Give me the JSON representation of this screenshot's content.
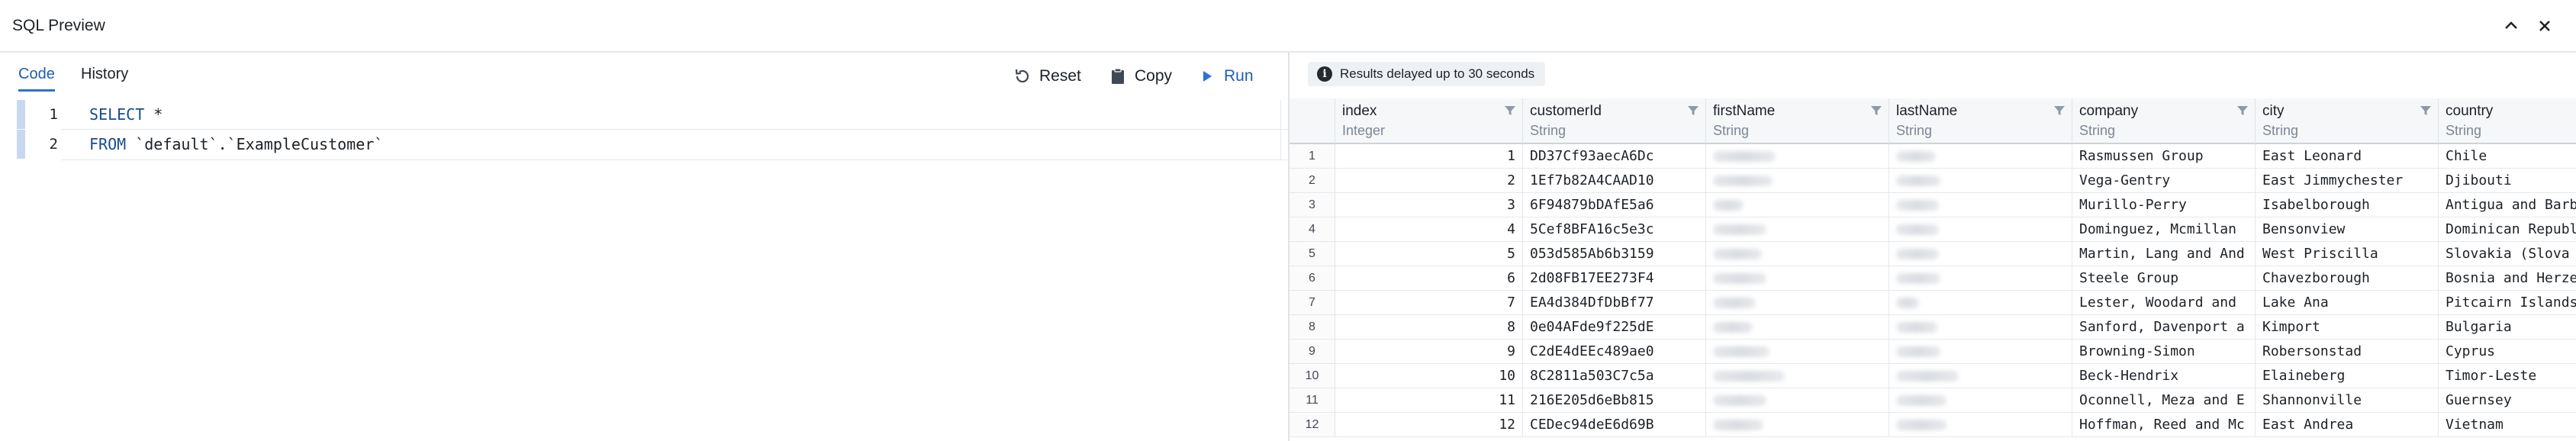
{
  "window": {
    "title": "SQL Preview",
    "icons": [
      "chevron-up-icon",
      "close-icon"
    ]
  },
  "left_panel": {
    "tabs": [
      {
        "label": "Code",
        "active": true
      },
      {
        "label": "History",
        "active": false
      }
    ],
    "toolbar": {
      "reset_label": "Reset",
      "copy_label": "Copy",
      "run_label": "Run"
    },
    "editor": {
      "lines": [
        {
          "num": "1",
          "keyword": "SELECT",
          "rest": " *"
        },
        {
          "num": "2",
          "keyword": "FROM",
          "rest": " `default`.`ExampleCustomer`"
        }
      ]
    }
  },
  "right_panel": {
    "badge": "Results delayed up to 30 seconds",
    "columns": [
      {
        "name": "index",
        "type": "Integer"
      },
      {
        "name": "customerId",
        "type": "String"
      },
      {
        "name": "firstName",
        "type": "String"
      },
      {
        "name": "lastName",
        "type": "String"
      },
      {
        "name": "company",
        "type": "String"
      },
      {
        "name": "city",
        "type": "String"
      },
      {
        "name": "country",
        "type": "String"
      }
    ],
    "rows": [
      {
        "row": "1",
        "index": "1",
        "customerId": "DD37Cf93aecA6Dc",
        "company": "Rasmussen Group",
        "city": "East Leonard",
        "country": "Chile"
      },
      {
        "row": "2",
        "index": "2",
        "customerId": "1Ef7b82A4CAAD10",
        "company": "Vega-Gentry",
        "city": "East Jimmychester",
        "country": "Djibouti"
      },
      {
        "row": "3",
        "index": "3",
        "customerId": "6F94879bDAfE5a6",
        "company": "Murillo-Perry",
        "city": "Isabelborough",
        "country": "Antigua and Barb"
      },
      {
        "row": "4",
        "index": "4",
        "customerId": "5Cef8BFA16c5e3c",
        "company": "Dominguez, Mcmillan",
        "city": "Bensonview",
        "country": "Dominican Republ"
      },
      {
        "row": "5",
        "index": "5",
        "customerId": "053d585Ab6b3159",
        "company": "Martin, Lang and And",
        "city": "West Priscilla",
        "country": "Slovakia (Slova"
      },
      {
        "row": "6",
        "index": "6",
        "customerId": "2d08FB17EE273F4",
        "company": "Steele Group",
        "city": "Chavezborough",
        "country": "Bosnia and Herze"
      },
      {
        "row": "7",
        "index": "7",
        "customerId": "EA4d384DfDbBf77",
        "company": "Lester, Woodard and",
        "city": "Lake Ana",
        "country": "Pitcairn Islands"
      },
      {
        "row": "8",
        "index": "8",
        "customerId": "0e04AFde9f225dE",
        "company": "Sanford, Davenport a",
        "city": "Kimport",
        "country": "Bulgaria"
      },
      {
        "row": "9",
        "index": "9",
        "customerId": "C2dE4dEEc489ae0",
        "company": "Browning-Simon",
        "city": "Robersonstad",
        "country": "Cyprus"
      },
      {
        "row": "10",
        "index": "10",
        "customerId": "8C2811a503C7c5a",
        "company": "Beck-Hendrix",
        "city": "Elaineberg",
        "country": "Timor-Leste"
      },
      {
        "row": "11",
        "index": "11",
        "customerId": "216E205d6eBb815",
        "company": "Oconnell, Meza and E",
        "city": "Shannonville",
        "country": "Guernsey"
      },
      {
        "row": "12",
        "index": "12",
        "customerId": "CEDec94deE6d69B",
        "company": "Hoffman, Reed and Mc",
        "city": "East Andrea",
        "country": "Vietnam"
      }
    ]
  }
}
